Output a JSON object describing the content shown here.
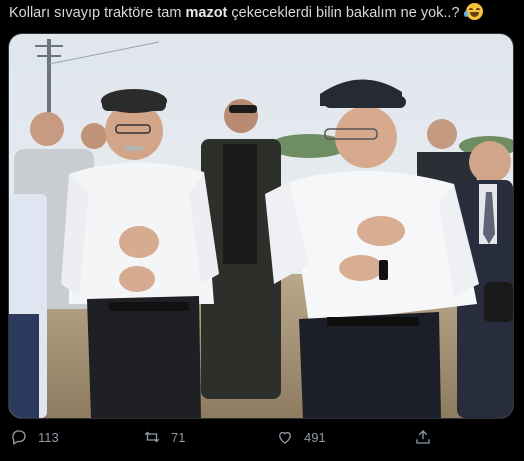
{
  "tweet": {
    "text_before": "Kolları sıvayıp traktöre tam ",
    "text_bold": "mazot",
    "text_after": " çekeceklerdi bilin bakalım ne yok..?"
  },
  "icons": {
    "emoji": "grinning-squinting-tears-emoji",
    "reply": "reply-icon",
    "retweet": "retweet-icon",
    "like": "heart-icon",
    "share": "share-icon"
  },
  "actions": {
    "reply_count": "113",
    "retweet_count": "71",
    "like_count": "491"
  },
  "colors": {
    "background": "#000000",
    "text": "#d9d9d9",
    "muted": "#8b98a5"
  }
}
